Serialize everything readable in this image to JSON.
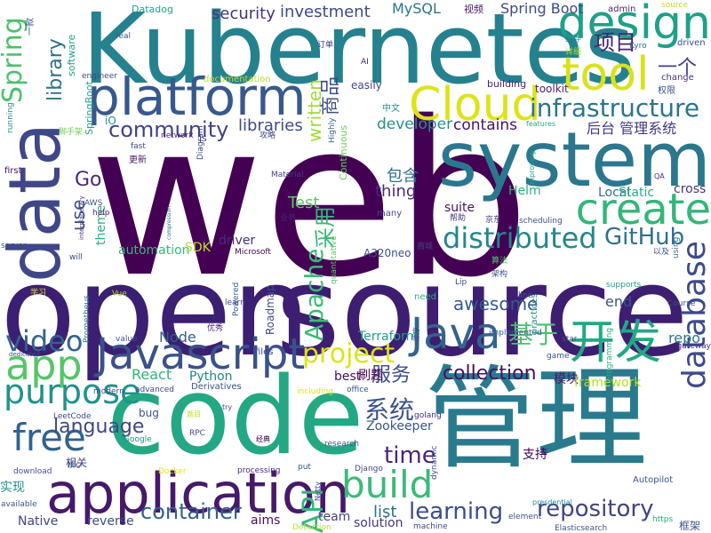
{
  "words": [
    {
      "text": "web",
      "color": "#440154",
      "big": true
    },
    {
      "text": "open",
      "color": "#3b1f72"
    },
    {
      "text": "source",
      "color": "#3d1e70"
    },
    {
      "text": "Kubernetes",
      "color": "#26818e"
    },
    {
      "text": "code",
      "color": "#23a883"
    },
    {
      "text": "管理",
      "color": "#2a7a8e"
    },
    {
      "text": "system",
      "color": "#2b778e"
    },
    {
      "text": "data",
      "color": "#3f4788"
    },
    {
      "text": "platform",
      "color": "#37598c"
    },
    {
      "text": "application",
      "color": "#46196a"
    },
    {
      "text": "Cloud",
      "color": "#dee318"
    },
    {
      "text": "design",
      "color": "#1fa088"
    },
    {
      "text": "tool",
      "color": "#d8e219"
    },
    {
      "text": "Java",
      "color": "#32648e"
    },
    {
      "text": "Javascript",
      "color": "#3b518b"
    },
    {
      "text": "app",
      "color": "#55c667"
    },
    {
      "text": "create",
      "color": "#34b679"
    },
    {
      "text": "开发",
      "color": "#22a884"
    },
    {
      "text": "distributed",
      "color": "#24868e"
    },
    {
      "text": "database",
      "color": "#3e4a89"
    },
    {
      "text": "build",
      "color": "#3aba76"
    },
    {
      "text": "free",
      "color": "#33628d"
    },
    {
      "text": "purpose",
      "color": "#21918c"
    },
    {
      "text": "video",
      "color": "#33628d"
    },
    {
      "text": "project",
      "color": "#dde318"
    },
    {
      "text": "infrastructure",
      "color": "#2b748e"
    },
    {
      "text": "community",
      "color": "#414287"
    },
    {
      "text": "GitHub",
      "color": "#2d718e"
    },
    {
      "text": "repository",
      "color": "#414487"
    },
    {
      "text": "Apache",
      "color": "#3bbb75"
    },
    {
      "text": "API",
      "color": "#35b779"
    },
    {
      "text": "container",
      "color": "#34608d"
    },
    {
      "text": "项目",
      "color": "#482576"
    },
    {
      "text": "Spring",
      "color": "#4ac16d"
    },
    {
      "text": "library",
      "color": "#2c728e"
    },
    {
      "text": "基于",
      "color": "#48c16e"
    },
    {
      "text": "learning",
      "color": "#3e4c8a"
    },
    {
      "text": "language",
      "color": "#3f4788"
    },
    {
      "text": "awesome",
      "color": "#38588c"
    },
    {
      "text": "系统",
      "color": "#3b528b"
    },
    {
      "text": "time",
      "color": "#482475"
    },
    {
      "text": "服务",
      "color": "#3e4c8a"
    },
    {
      "text": "collection",
      "color": "#471063"
    },
    {
      "text": "security",
      "color": "#46327e"
    },
    {
      "text": "investment",
      "color": "#3e4989"
    },
    {
      "text": "Spring Boot",
      "color": "#3e4989"
    },
    {
      "text": "MySQL",
      "color": "#2a768e"
    },
    {
      "text": "一个",
      "color": "#433d84"
    },
    {
      "text": "written",
      "color": "#a2da37"
    },
    {
      "text": "商品",
      "color": "#3c4f8a"
    },
    {
      "text": "libraries",
      "color": "#3f4889"
    },
    {
      "text": "developer",
      "color": "#21918c"
    },
    {
      "text": "contains",
      "color": "#471365"
    },
    {
      "text": "后台 管理系统",
      "color": "#453882"
    },
    {
      "text": "Go",
      "color": "#482979"
    },
    {
      "text": "use",
      "color": "#3b528b"
    },
    {
      "text": "thing",
      "color": "#472c7a"
    },
    {
      "text": "Test",
      "color": "#5cc863"
    },
    {
      "text": "包含",
      "color": "#2d708e"
    },
    {
      "text": "Helm",
      "color": "#2db27d"
    },
    {
      "text": "suite",
      "color": "#471365"
    },
    {
      "text": "Local",
      "color": "#2e6e8e"
    },
    {
      "text": "Static",
      "color": "#2ab07f"
    },
    {
      "text": "cross",
      "color": "#463480"
    },
    {
      "text": "采用",
      "color": "#38b977"
    },
    {
      "text": "automation",
      "color": "#37b878"
    },
    {
      "text": "driver",
      "color": "#472e7c"
    },
    {
      "text": "SDK",
      "color": "#bade28"
    },
    {
      "text": "theme",
      "color": "#29af7f"
    },
    {
      "text": "React",
      "color": "#2eb37c"
    },
    {
      "text": "Python",
      "color": "#25838e"
    },
    {
      "text": "Node",
      "color": "#355e8d"
    },
    {
      "text": "Terraform",
      "color": "#1f9e89"
    },
    {
      "text": "end",
      "color": "#3b528b"
    },
    {
      "text": "repo",
      "color": "#2a788e"
    },
    {
      "text": "模块",
      "color": "#481b6d"
    },
    {
      "text": "framework",
      "color": "#b5de2b"
    },
    {
      "text": "best",
      "color": "#470e61"
    },
    {
      "text": "刷题",
      "color": "#440154"
    },
    {
      "text": "Zookeeper",
      "color": "#3a548c"
    },
    {
      "text": "支持",
      "color": "#440256"
    },
    {
      "text": "list",
      "color": "#2c718e"
    },
    {
      "text": "team",
      "color": "#3f4788"
    },
    {
      "text": "solution",
      "color": "#453781"
    },
    {
      "text": "aims",
      "color": "#471063"
    },
    {
      "text": "reverse",
      "color": "#3e4a89"
    },
    {
      "text": "Native",
      "color": "#3e4989"
    },
    {
      "text": "实现",
      "color": "#228d8d"
    },
    {
      "text": "Datadog",
      "color": "#20a386"
    },
    {
      "text": "视频",
      "color": "#471365"
    },
    {
      "text": "admin",
      "color": "#481f70"
    },
    {
      "text": "source",
      "color": "#bddf26",
      "small": true
    },
    {
      "text": "real",
      "color": "#3b528b"
    },
    {
      "text": "software",
      "color": "#20a486"
    },
    {
      "text": "engineer",
      "color": "#3e4a89"
    },
    {
      "text": "running",
      "color": "#23898e"
    },
    {
      "text": "SpringBoot",
      "color": "#1fa188"
    },
    {
      "text": "documentation",
      "color": "#b8de29"
    },
    {
      "text": "easily",
      "color": "#3f4788"
    },
    {
      "text": "building",
      "color": "#482878"
    },
    {
      "text": "toolkit",
      "color": "#481d6f"
    },
    {
      "text": "change",
      "color": "#46327e"
    },
    {
      "text": "driven",
      "color": "#3e4c8a"
    },
    {
      "text": "权限",
      "color": "#3b528b"
    },
    {
      "text": "Kyro",
      "color": "#2c718e"
    },
    {
      "text": "组件",
      "color": "#26828e"
    },
    {
      "text": "详细",
      "color": "#a8db34"
    },
    {
      "text": "订单",
      "color": "#46337f"
    },
    {
      "text": "AI",
      "color": "#482173"
    },
    {
      "text": "中文",
      "color": "#21908d"
    },
    {
      "text": "攻略",
      "color": "#3f4889"
    },
    {
      "text": "network",
      "color": "#482878"
    },
    {
      "text": "fast",
      "color": "#404588"
    },
    {
      "text": "更新",
      "color": "#48186a"
    },
    {
      "text": "Diagram",
      "color": "#404688"
    },
    {
      "text": "Material",
      "color": "#414487"
    },
    {
      "text": "Highly",
      "color": "#33638d"
    },
    {
      "text": "Continuous",
      "color": "#6ece58"
    },
    {
      "text": "features",
      "color": "#25ab82"
    },
    {
      "text": "QA",
      "color": "#472d7b"
    },
    {
      "text": "improving",
      "color": "#1fa287"
    },
    {
      "text": "compression",
      "color": "#2c738e"
    },
    {
      "text": "interplanetary",
      "color": "#46327e"
    },
    {
      "text": "AWS",
      "color": "#3a548c"
    },
    {
      "text": "help",
      "color": "#481d6f"
    },
    {
      "text": "业务",
      "color": "#482576"
    },
    {
      "text": "帮助",
      "color": "#45337d"
    },
    {
      "text": "京东",
      "color": "#443a83"
    },
    {
      "text": "scheduling",
      "color": "#3b518b"
    },
    {
      "text": "using",
      "color": "#2e6f8e"
    },
    {
      "text": "以及",
      "color": "#3d4e8a"
    },
    {
      "text": "Microsoft",
      "color": "#440154"
    },
    {
      "text": "A320neo",
      "color": "#3b528b"
    },
    {
      "text": "商城",
      "color": "#414487"
    },
    {
      "text": "算法",
      "color": "#50c46a"
    },
    {
      "text": "Lip",
      "color": "#3e4989"
    },
    {
      "text": "架构",
      "color": "#3b518b"
    },
    {
      "text": "quantitative",
      "color": "#5ec962"
    },
    {
      "text": "Powered",
      "color": "#34618d"
    },
    {
      "text": "first",
      "color": "#471063"
    },
    {
      "text": "server",
      "color": "#3b528b"
    },
    {
      "text": "will",
      "color": "#3f4788"
    },
    {
      "text": "学习",
      "color": "#dde318"
    },
    {
      "text": "Vue",
      "color": "#bddf26"
    },
    {
      "text": "learn",
      "color": "#3f4788"
    },
    {
      "text": "need",
      "color": "#2ab07f"
    },
    {
      "text": "line",
      "color": "#3a548c"
    },
    {
      "text": "supports",
      "color": "#1fa088"
    },
    {
      "text": "Course",
      "color": "#3b528b"
    },
    {
      "text": "Prometheus",
      "color": "#2d708e"
    },
    {
      "text": "dedicated",
      "color": "#3b528b"
    },
    {
      "text": "value",
      "color": "#3b528b"
    },
    {
      "text": "优秀",
      "color": "#481b6d"
    },
    {
      "text": "Roadmap",
      "color": "#3e4c8a"
    },
    {
      "text": "implemented",
      "color": "#38588c"
    },
    {
      "text": "star",
      "color": "#3b528b"
    },
    {
      "text": "game",
      "color": "#3b528b"
    },
    {
      "text": "gateway",
      "color": "#46337f"
    },
    {
      "text": "practices",
      "color": "#21908d"
    },
    {
      "text": "files",
      "color": "#3f4788"
    },
    {
      "text": "advanced",
      "color": "#3f4788"
    },
    {
      "text": "Derivatives",
      "color": "#3b518b"
    },
    {
      "text": "modern",
      "color": "#3e4a89"
    },
    {
      "text": "including",
      "color": "#dde318"
    },
    {
      "text": "office",
      "color": "#3b528b"
    },
    {
      "text": "golang",
      "color": "#482878"
    },
    {
      "text": "programming",
      "color": "#2ab07f"
    },
    {
      "text": "LeetCode",
      "color": "#3f4788"
    },
    {
      "text": "bug",
      "color": "#3b528b"
    },
    {
      "text": "题目",
      "color": "#bddf26"
    },
    {
      "text": "Google",
      "color": "#21908d"
    },
    {
      "text": "RPC",
      "color": "#3e4a89"
    },
    {
      "text": "经典",
      "color": "#440154"
    },
    {
      "text": "research",
      "color": "#3b528b"
    },
    {
      "text": "dynamic",
      "color": "#3b528b"
    },
    {
      "text": "Django",
      "color": "#3f4788"
    },
    {
      "text": "processing",
      "color": "#482878"
    },
    {
      "text": "put",
      "color": "#3b528b"
    },
    {
      "text": "Netty",
      "color": "#3e4a89"
    },
    {
      "text": "presdential",
      "color": "#23898e"
    },
    {
      "text": "Autopilot",
      "color": "#3b528b"
    },
    {
      "text": "download",
      "color": "#3b528b"
    },
    {
      "text": "核心",
      "color": "#3e4989"
    },
    {
      "text": "相关",
      "color": "#3f4788"
    },
    {
      "text": "Docker",
      "color": "#dde318"
    },
    {
      "text": "available",
      "color": "#3b528b"
    },
    {
      "text": "Detection",
      "color": "#b8de29"
    },
    {
      "text": "machine",
      "color": "#3f4788"
    },
    {
      "text": "element",
      "color": "#3b528b"
    },
    {
      "text": "Elasticsearch",
      "color": "#3b528b"
    },
    {
      "text": "https",
      "color": "#25ab82"
    },
    {
      "text": "框架",
      "color": "#3b528b"
    },
    {
      "text": "一款",
      "color": "#3b528b"
    },
    {
      "text": "iO",
      "color": "#21908d"
    },
    {
      "text": "脚手架",
      "color": "#6ece58"
    },
    {
      "text": "js",
      "color": "#3f4788"
    },
    {
      "text": "many",
      "color": "#3e4989"
    },
    {
      "text": "try",
      "color": "#3b528b"
    },
    {
      "text": "顺序",
      "color": "#3f4788"
    }
  ]
}
